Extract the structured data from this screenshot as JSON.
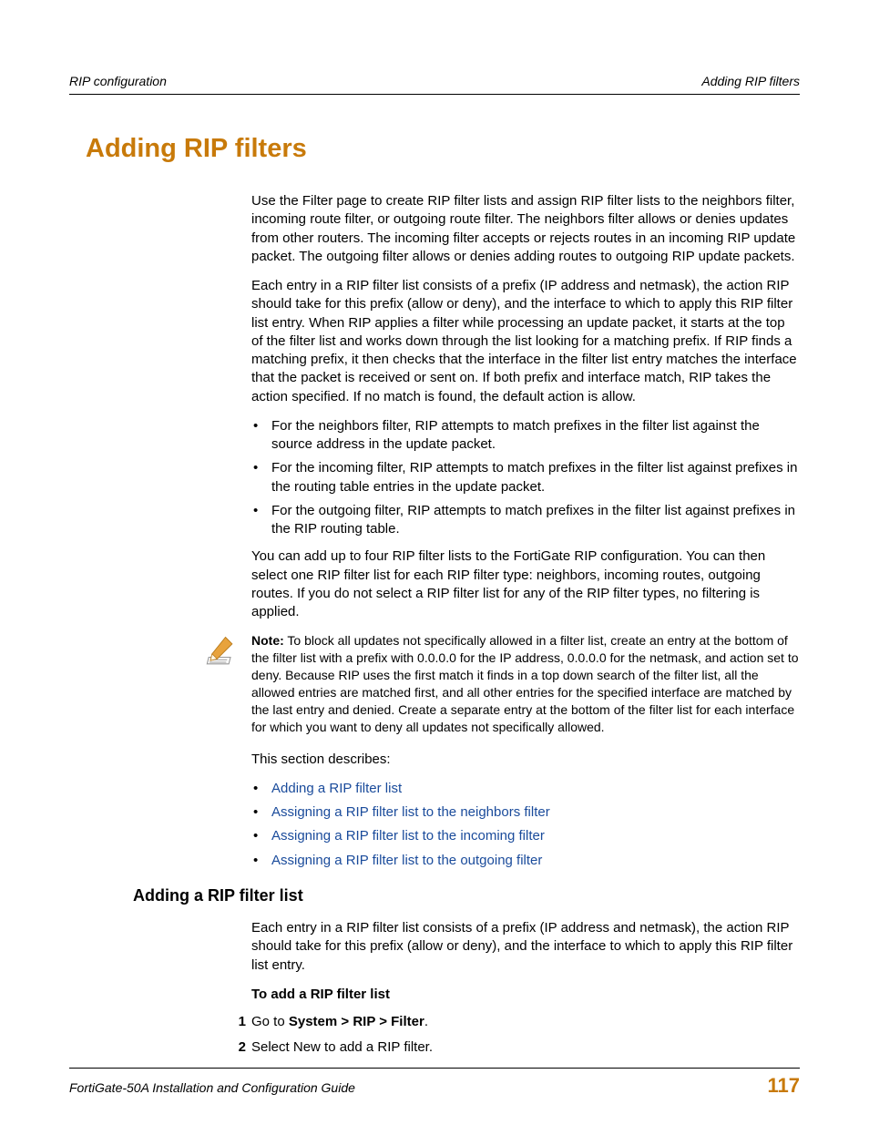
{
  "header": {
    "left": "RIP configuration",
    "right": "Adding RIP filters"
  },
  "title": "Adding RIP filters",
  "para1": "Use the Filter page to create RIP filter lists and assign RIP filter lists to the neighbors filter, incoming route filter, or outgoing route filter. The neighbors filter allows or denies updates from other routers. The incoming filter accepts or rejects routes in an incoming RIP update packet. The outgoing filter allows or denies adding routes to outgoing RIP update packets.",
  "para2": "Each entry in a RIP filter list consists of a prefix (IP address and netmask), the action RIP should take for this prefix (allow or deny), and the interface to which to apply this RIP filter list entry. When RIP applies a filter while processing an update packet, it starts at the top of the filter list and works down through the list looking for a matching prefix. If RIP finds a matching prefix, it then checks that the interface in the filter list entry matches the interface that the packet is received or sent on. If both prefix and interface match, RIP takes the action specified. If no match is found, the default action is allow.",
  "bullets1": [
    "For the neighbors filter, RIP attempts to match prefixes in the filter list against the source address in the update packet.",
    "For the incoming filter, RIP attempts to match prefixes in the filter list against prefixes in the routing table entries in the update packet.",
    "For the outgoing filter, RIP attempts to match prefixes in the filter list against prefixes in the RIP routing table."
  ],
  "para3": "You can add up to four RIP filter lists to the FortiGate RIP configuration. You can then select one RIP filter list for each RIP filter type: neighbors, incoming routes, outgoing routes. If you do not select a RIP filter list for any of the RIP filter types, no filtering is applied.",
  "note_label": "Note:",
  "note_body": " To block all updates not specifically allowed in a filter list, create an entry at the bottom of the filter list with a prefix with 0.0.0.0 for the IP address, 0.0.0.0 for the netmask, and action set to deny. Because RIP uses the first match it finds in a top down search of the filter list, all the allowed entries are matched first, and all other entries for the specified interface are matched by the last entry and denied. Create a separate entry at the bottom of the filter list for each interface for which you want to deny all updates not specifically allowed.",
  "para4": "This section describes:",
  "links": [
    "Adding a RIP filter list",
    "Assigning a RIP filter list to the neighbors filter",
    "Assigning a RIP filter list to the incoming filter",
    "Assigning a RIP filter list to the outgoing filter"
  ],
  "subheading": "Adding a RIP filter list",
  "para5": "Each entry in a RIP filter list consists of a prefix (IP address and netmask), the action RIP should take for this prefix (allow or deny), and the interface to which to apply this RIP filter list entry.",
  "proc_title": "To add a RIP filter list",
  "steps": {
    "s1_pre": "Go to ",
    "s1_bold": "System > RIP > Filter",
    "s1_post": ".",
    "s2": "Select New to add a RIP filter."
  },
  "footer": {
    "left": "FortiGate-50A Installation and Configuration Guide",
    "page": "117"
  }
}
